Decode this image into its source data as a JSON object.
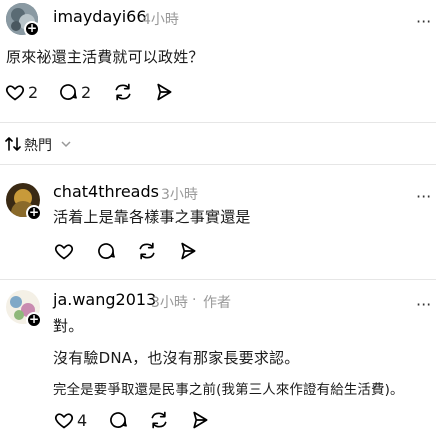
{
  "main_post": {
    "username": "imaydayi66",
    "time": "4小時",
    "text": "原來祕還主活費就可以政姓？",
    "counts": {
      "likes": "2",
      "replies": "2"
    }
  },
  "sort": {
    "label": "熱門"
  },
  "replies": [
    {
      "username": "chat4threads",
      "time": "3小時",
      "lines": [
        "活着上是靠各樣事之事實還是"
      ]
    },
    {
      "username": "ja.wang2013",
      "time": "3小時",
      "author_tag": "作者",
      "lines": [
        "對。",
        "沒有驗DNA，也沒有那家長要求認。",
        "完全是要爭取還是民事之前(我第三人來作證有給生活費)。"
      ],
      "counts": {
        "likes": "4"
      }
    }
  ]
}
